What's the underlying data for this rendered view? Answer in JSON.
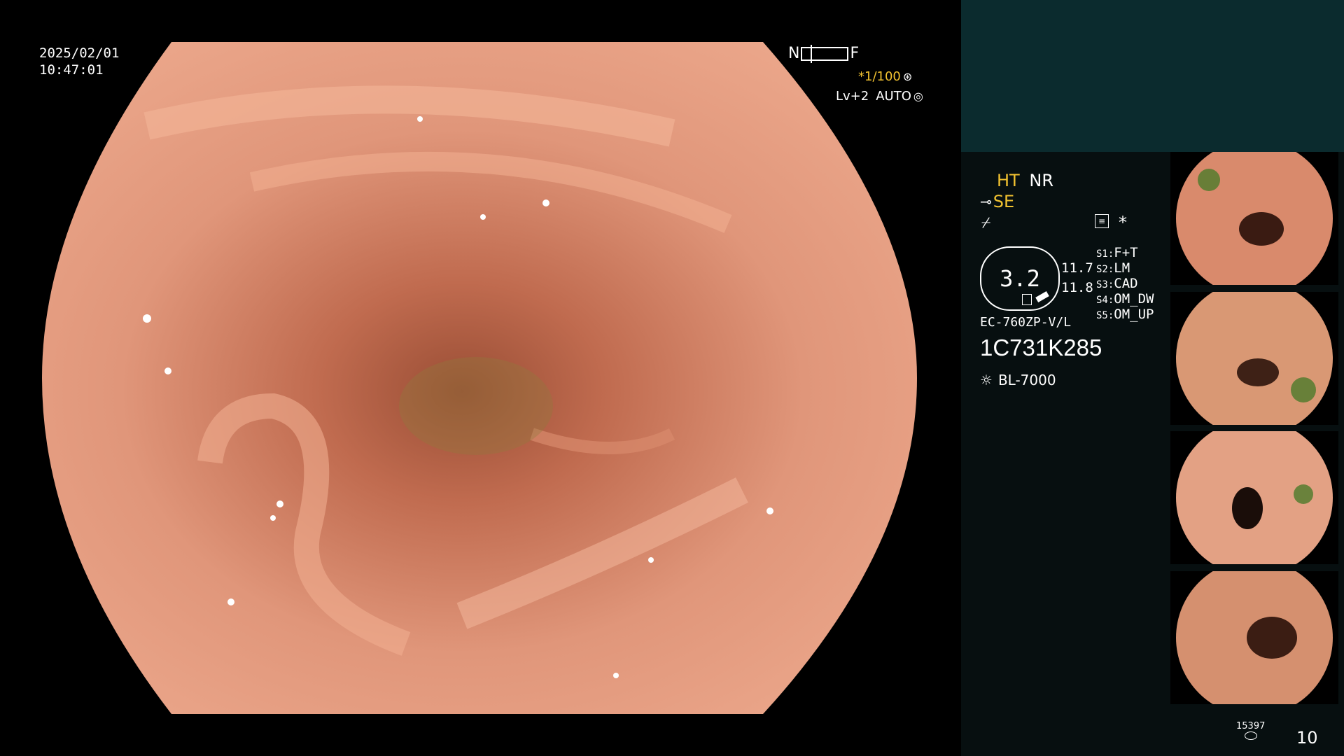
{
  "timestamp": {
    "date": "2025/02/01",
    "time": "10:47:01"
  },
  "focus_scale": {
    "near_label": "N",
    "far_label": "F"
  },
  "shutter": {
    "value": "*1/100"
  },
  "enhance": {
    "level": "Lv+2",
    "mode": "AUTO"
  },
  "modes": {
    "ht": "HT",
    "nr": "NR",
    "se": "SE"
  },
  "zoom": {
    "value": "3.2",
    "side_top": "11.7",
    "side_bottom": "11.8"
  },
  "scope": {
    "model": "EC-760ZP-V/L",
    "serial": "1C731K285",
    "light_source": "BL-7000"
  },
  "switches": [
    {
      "key": "S1:",
      "value": "F+T"
    },
    {
      "key": "S2:",
      "value": "LM"
    },
    {
      "key": "S3:",
      "value": "CAD"
    },
    {
      "key": "S4:",
      "value": "OM_DW"
    },
    {
      "key": "S5:",
      "value": "OM_UP"
    }
  ],
  "footer": {
    "image_count": "15397",
    "page": "10"
  },
  "colors": {
    "accent": "#f2c230",
    "panel": "#070f10",
    "panel_top": "#0b2b2e",
    "mucosa": "#d98a6c"
  },
  "icons": [
    "focus-bar-icon",
    "shutter-icon",
    "auto-icon",
    "se-icon",
    "star-icon",
    "settings-icon",
    "lamp-icon",
    "storage-icon"
  ]
}
